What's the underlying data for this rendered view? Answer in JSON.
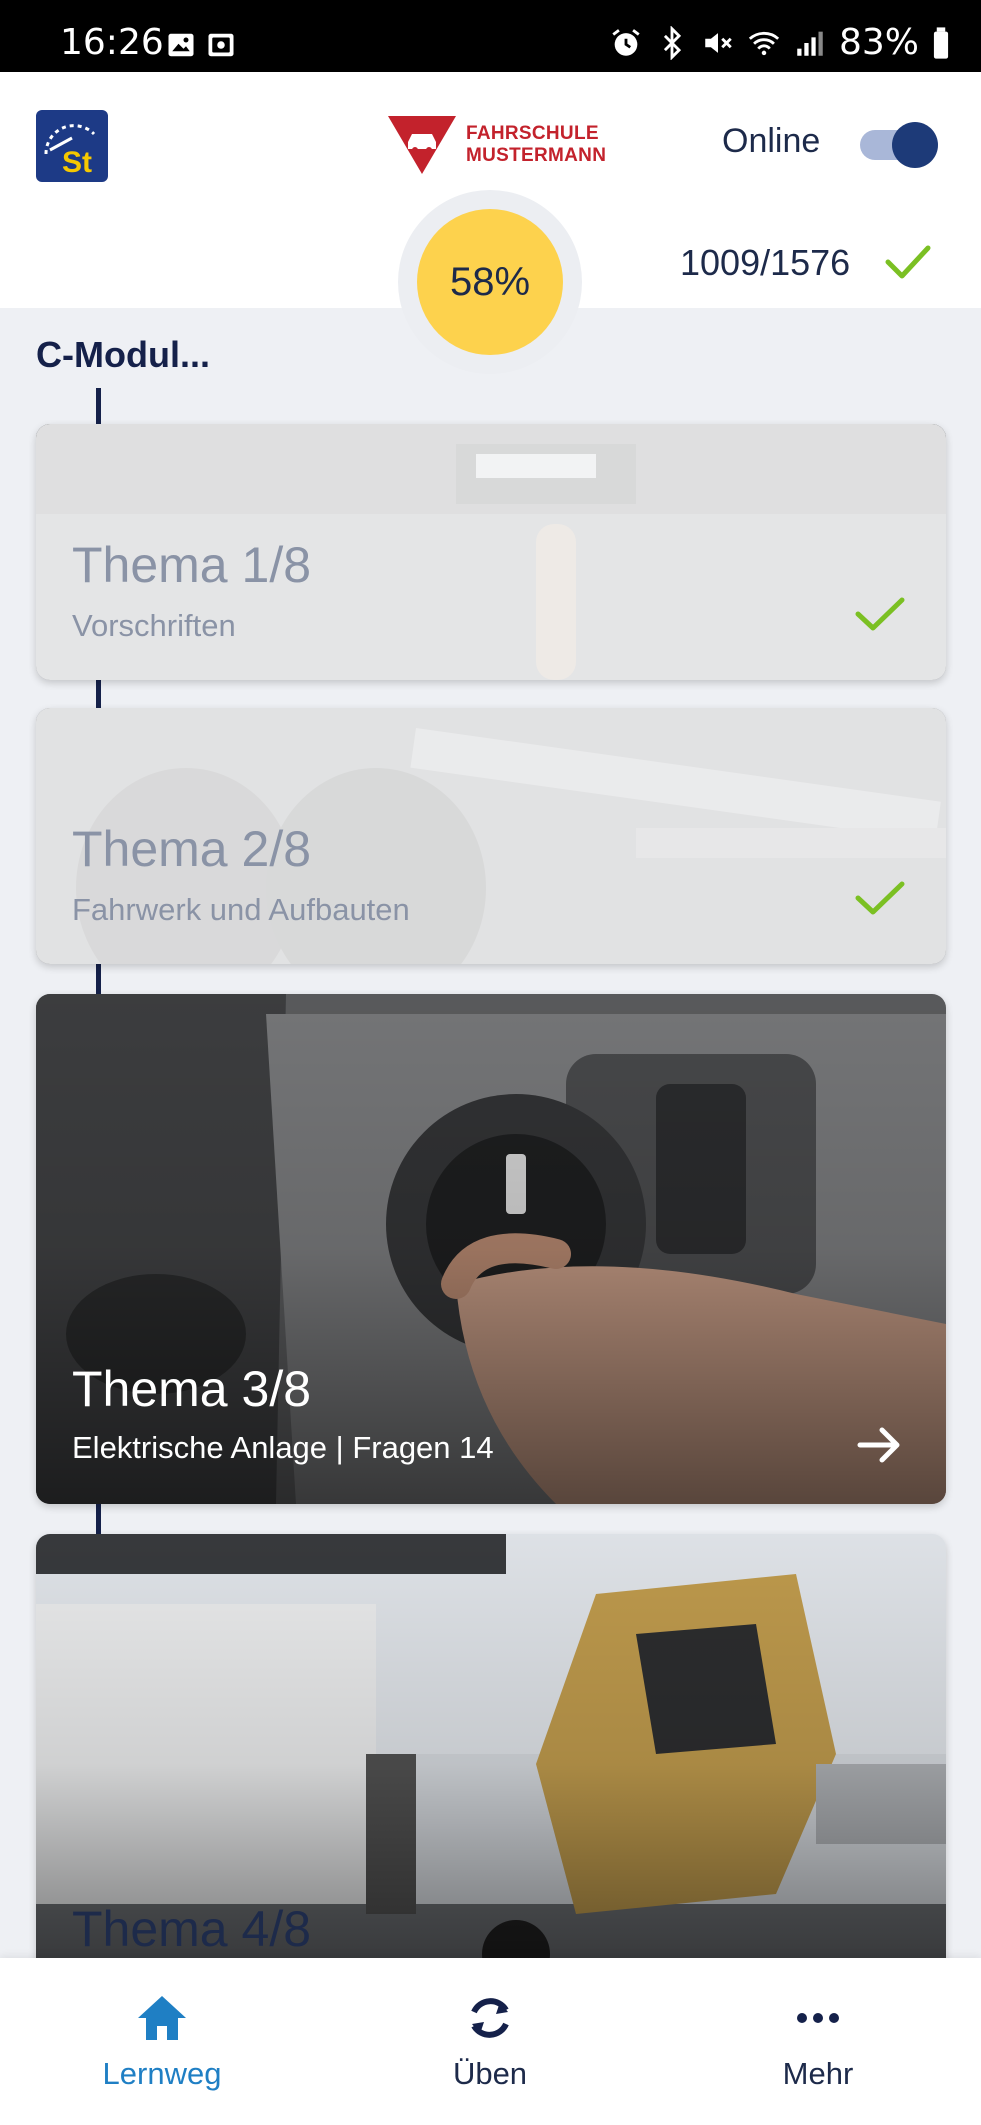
{
  "status_bar": {
    "time": "16:26",
    "battery": "83%",
    "left_icons": [
      "image-icon",
      "screenshot-icon"
    ],
    "right_icons": [
      "alarm-icon",
      "bluetooth-icon",
      "mute-icon",
      "wifi-icon",
      "signal-icon",
      "battery-icon"
    ]
  },
  "header": {
    "brand_line1": "FAHRSCHULE",
    "brand_line2": "MUSTERMANN",
    "online_label": "Online",
    "online_enabled": true,
    "progress_label": "58%",
    "progress_value": 0.58,
    "counter": "1009/1576"
  },
  "section": {
    "title": "C-Modul..."
  },
  "topics": [
    {
      "title": "Thema 1/8",
      "subtitle": "Vorschriften",
      "state": "done"
    },
    {
      "title": "Thema 2/8",
      "subtitle": "Fahrwerk und Aufbauten",
      "state": "done"
    },
    {
      "title": "Thema 3/8",
      "subtitle": "Elektrische Anlage | Fragen 14",
      "state": "active"
    },
    {
      "title": "Thema 4/8",
      "subtitle": "",
      "state": "upcoming"
    }
  ],
  "bottom_nav": [
    {
      "label": "Lernweg",
      "icon": "home-icon",
      "active": true
    },
    {
      "label": "Üben",
      "icon": "refresh-icon",
      "active": false
    },
    {
      "label": "Mehr",
      "icon": "more-icon",
      "active": false
    }
  ],
  "colors": {
    "navy": "#15214a",
    "accent_blue": "#1f7fc4",
    "progress_yellow": "#fdd24d",
    "check_green": "#7bc023",
    "brand_red": "#c3222c"
  }
}
